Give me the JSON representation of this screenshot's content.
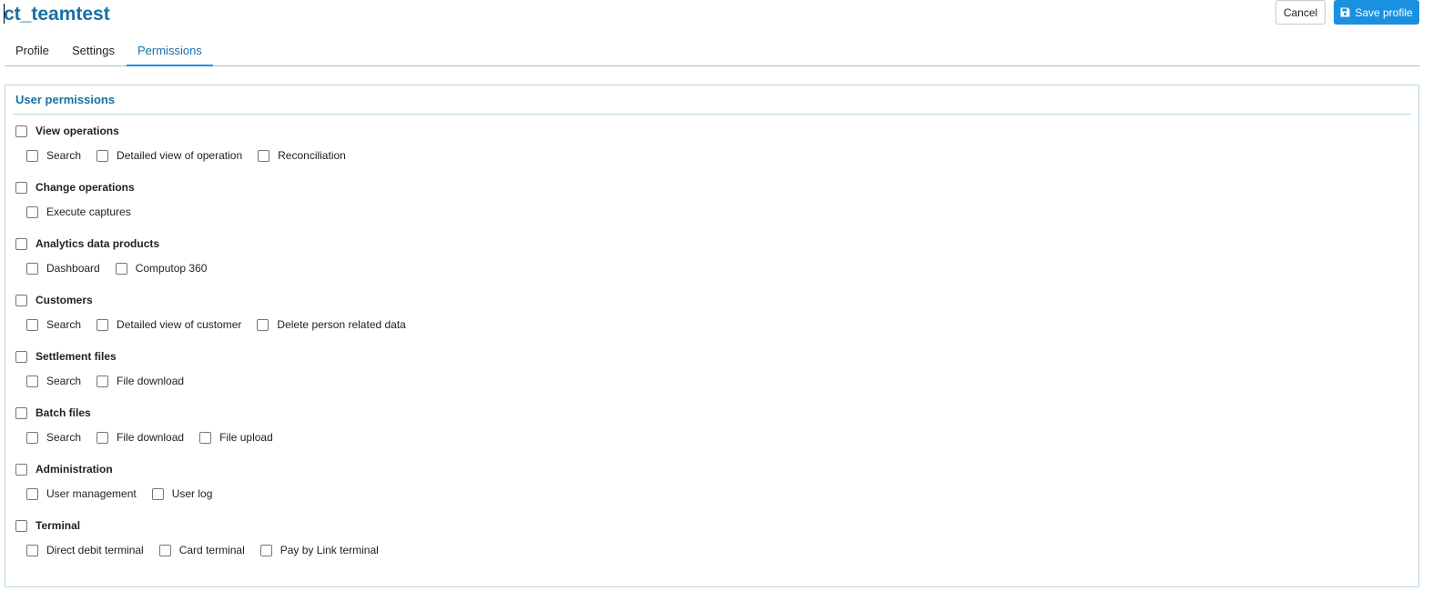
{
  "header": {
    "title": "ct_teamtest",
    "cancel_label": "Cancel",
    "save_label": "Save profile",
    "save_icon": "floppy-disk-icon",
    "accent_color": "#1a90e0"
  },
  "tabs": [
    {
      "label": "Profile",
      "active": false
    },
    {
      "label": "Settings",
      "active": false
    },
    {
      "label": "Permissions",
      "active": true
    }
  ],
  "permissions": {
    "heading": "User permissions",
    "groups": [
      {
        "label": "View operations",
        "checked": false,
        "items": [
          {
            "label": "Search",
            "checked": false
          },
          {
            "label": "Detailed view of operation",
            "checked": false
          },
          {
            "label": "Reconciliation",
            "checked": false
          }
        ]
      },
      {
        "label": "Change operations",
        "checked": false,
        "items": [
          {
            "label": "Execute captures",
            "checked": false
          }
        ]
      },
      {
        "label": "Analytics data products",
        "checked": false,
        "items": [
          {
            "label": "Dashboard",
            "checked": false
          },
          {
            "label": "Computop 360",
            "checked": false
          }
        ]
      },
      {
        "label": "Customers",
        "checked": false,
        "items": [
          {
            "label": "Search",
            "checked": false
          },
          {
            "label": "Detailed view of customer",
            "checked": false
          },
          {
            "label": "Delete person related data",
            "checked": false
          }
        ]
      },
      {
        "label": "Settlement files",
        "checked": false,
        "items": [
          {
            "label": "Search",
            "checked": false
          },
          {
            "label": "File download",
            "checked": false
          }
        ]
      },
      {
        "label": "Batch files",
        "checked": false,
        "items": [
          {
            "label": "Search",
            "checked": false
          },
          {
            "label": "File download",
            "checked": false
          },
          {
            "label": "File upload",
            "checked": false
          }
        ]
      },
      {
        "label": "Administration",
        "checked": false,
        "items": [
          {
            "label": "User management",
            "checked": false
          },
          {
            "label": "User log",
            "checked": false
          }
        ]
      },
      {
        "label": "Terminal",
        "checked": false,
        "items": [
          {
            "label": "Direct debit terminal",
            "checked": false
          },
          {
            "label": "Card terminal",
            "checked": false
          },
          {
            "label": "Pay by Link terminal",
            "checked": false
          }
        ]
      }
    ]
  }
}
